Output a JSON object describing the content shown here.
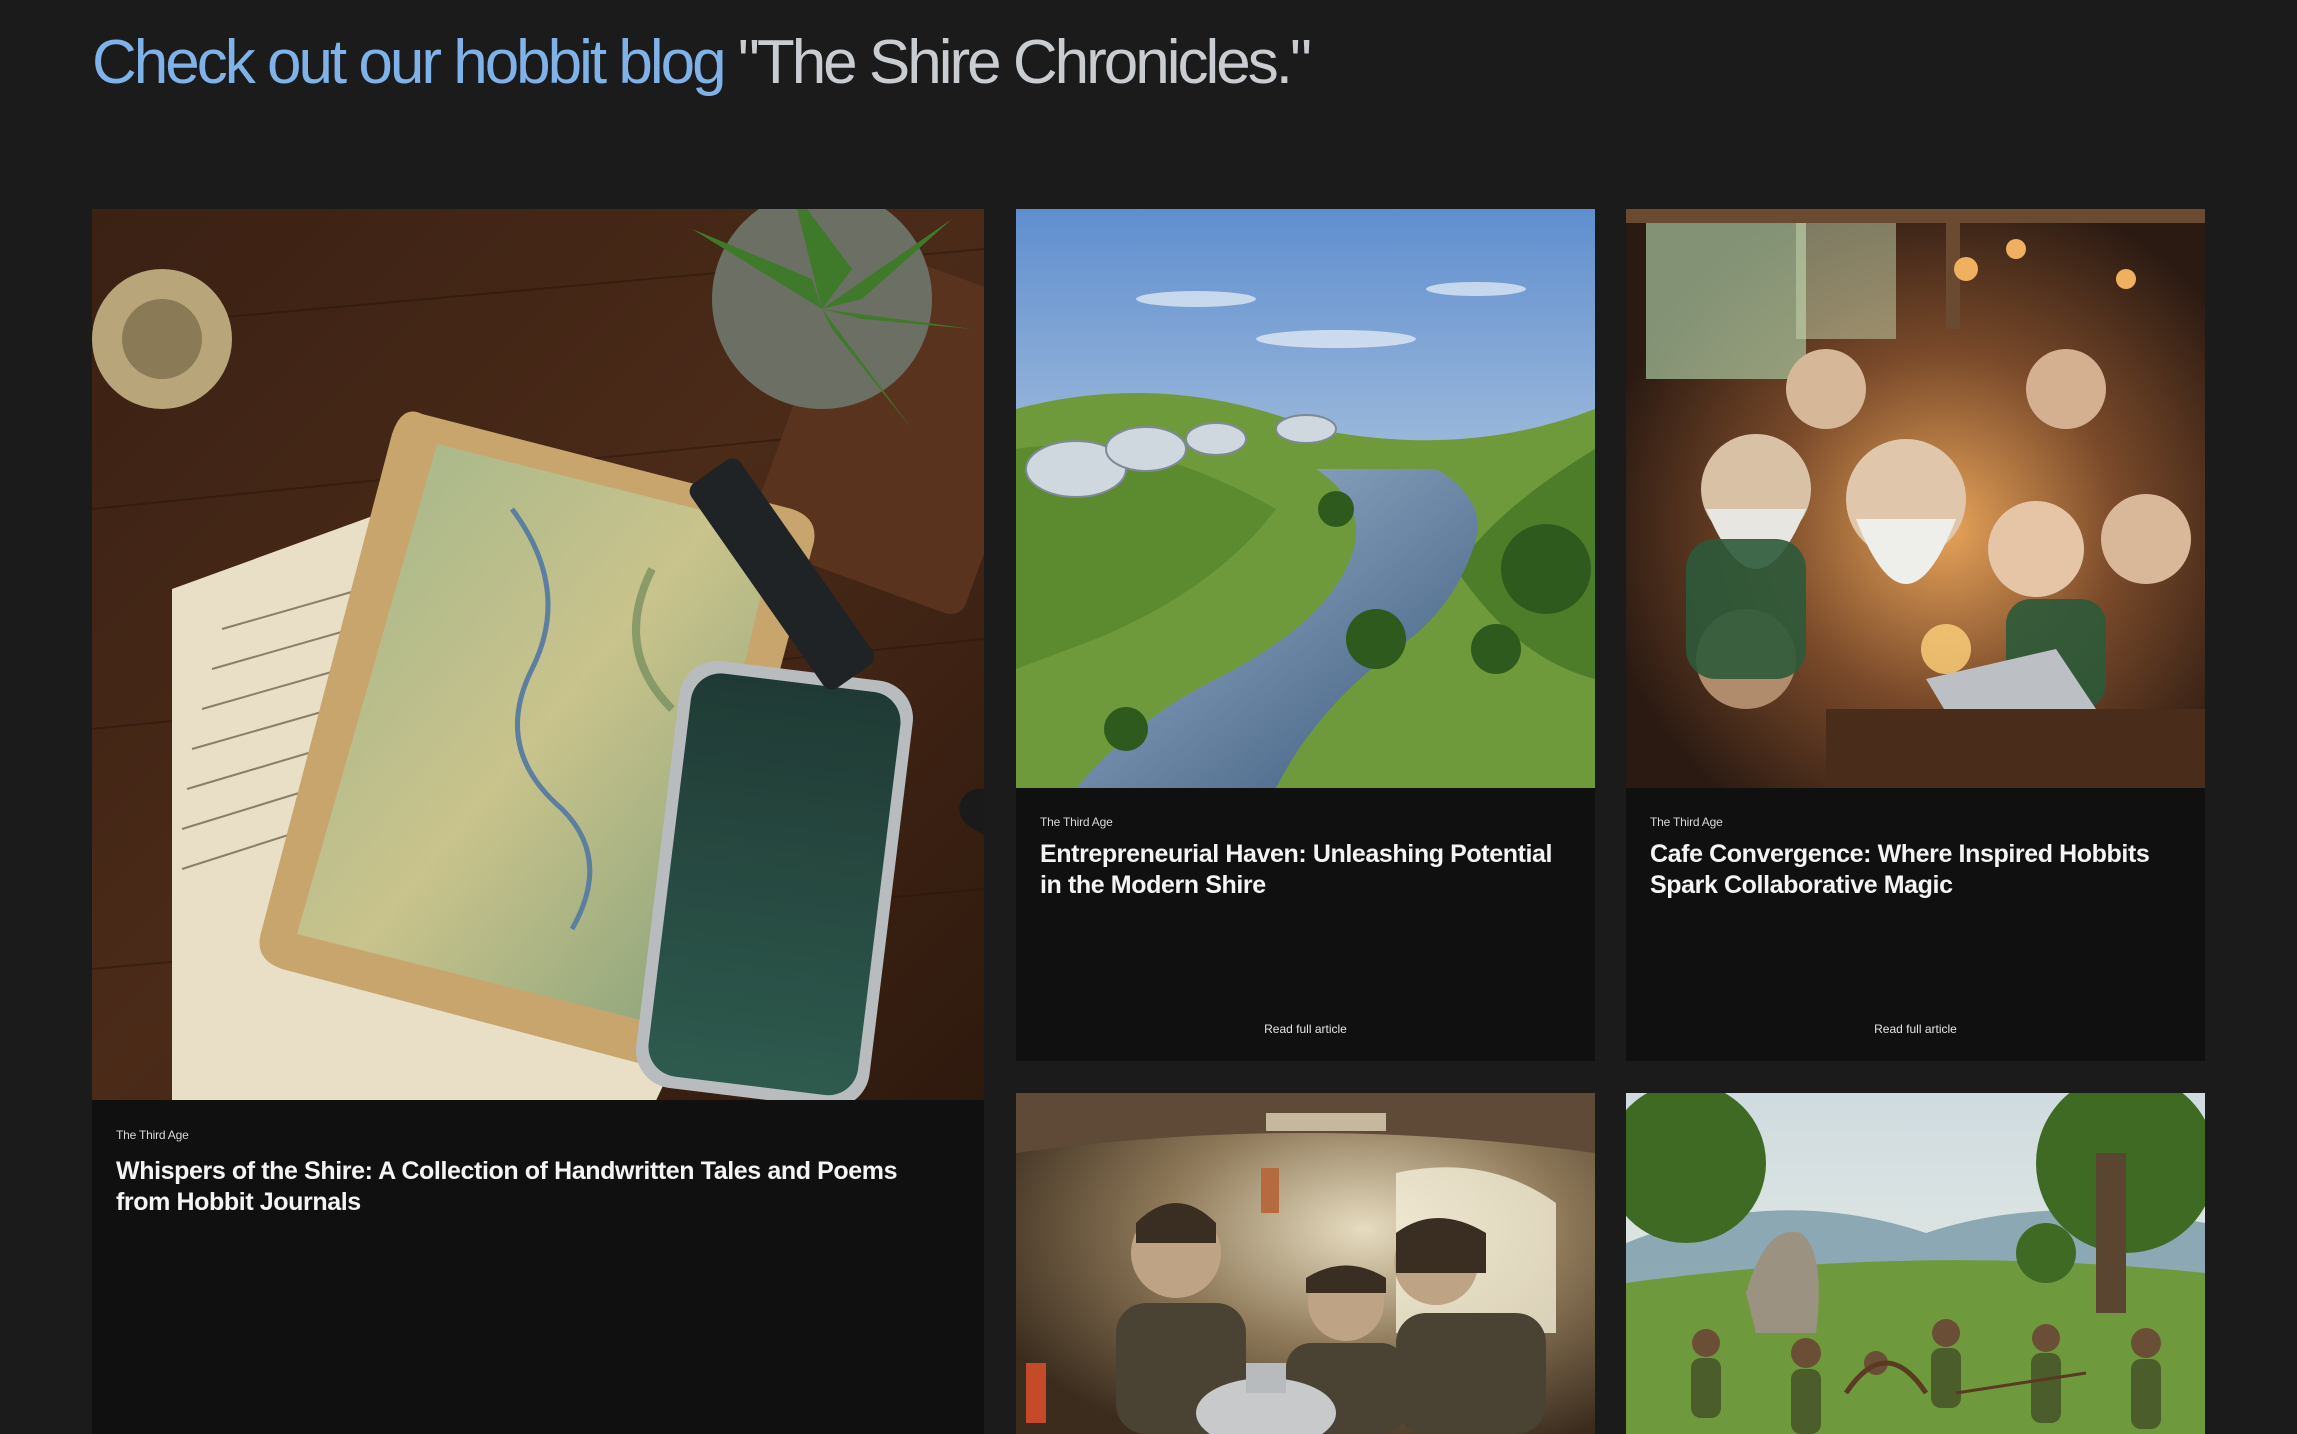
{
  "heading": {
    "accent": "Check out our hobbit blog",
    "rest": " \"The Shire Chronicles.\""
  },
  "articles": [
    {
      "category": "The Third Age",
      "title": "Whispers of the Shire: A Collection of Handwritten Tales and Poems from Hobbit Journals",
      "image_icon": "journal-map-phone-image"
    },
    {
      "category": "The Third Age",
      "title": "Entrepreneurial Haven: Unleashing Potential in the Modern Shire",
      "link": "Read full article",
      "image_icon": "shire-landscape-image"
    },
    {
      "category": "The Third Age",
      "title": "Cafe Convergence: Where Inspired Hobbits Spark Collaborative Magic",
      "link": "Read full article",
      "image_icon": "hobbit-cafe-image"
    },
    {
      "image_icon": "hobbit-kitchen-image"
    },
    {
      "image_icon": "archery-meadow-image"
    }
  ],
  "colors": {
    "background": "#1b1b1b",
    "card": "#101010",
    "heading_accent": "#7fb2e8",
    "heading_rest": "#c9cdd2"
  }
}
